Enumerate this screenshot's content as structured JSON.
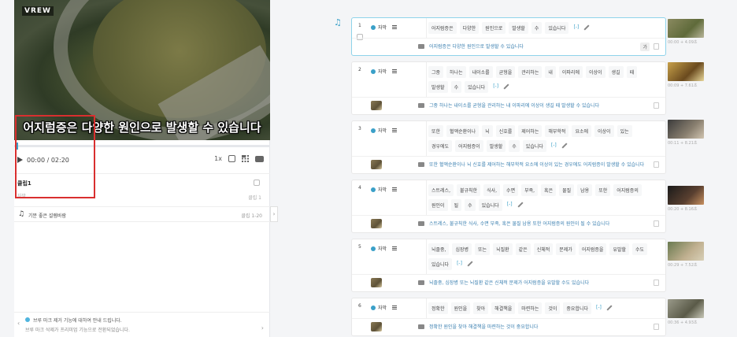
{
  "player": {
    "logo": "VREW",
    "subtitle": "어지럼증은 다양한 원인으로 발생할 수 있습니다",
    "time": "00:00  / 02:20",
    "speed": "1x",
    "progress": 0.01
  },
  "clip_panel": {
    "title": "클립1",
    "sub": "자막",
    "count": "클립 1",
    "music_label": "기분 좋은 설렘바람",
    "music_range": "클립 1-20"
  },
  "notice": {
    "line1": "브루 마크 제거 기능에 대하여 안내 드립니다.",
    "line2": "브루 마크 삭제가 프리미엄 기능으로 전환되었습니다."
  },
  "speaker_label": "자막",
  "clips": [
    {
      "num": "1",
      "words": [
        "어지럼증은",
        "다양한",
        "원인으로",
        "발생할",
        "수",
        "있습니다"
      ],
      "caption": "어지럼증은 다양한 원인으로 발생할 수 있습니다",
      "badge": "가",
      "thumb_time": "00:00 + 4.09초"
    },
    {
      "num": "2",
      "words": [
        "그중",
        "하나는",
        "내이소를",
        "균형을",
        "관리하는",
        "내",
        "이파리에",
        "이상이",
        "생길",
        "때",
        "발생할",
        "수",
        "있습니다"
      ],
      "caption": "그중 하나는 내이소를 균형을 관리하는 내 이파리에 이상이 생길 때 발생할 수 있습니다",
      "thumb_time": "00:09 + 7.61초"
    },
    {
      "num": "3",
      "words": [
        "또한",
        "혈액순환이나",
        "뇌",
        "신호를",
        "제어하는",
        "해부학적",
        "요소에",
        "이상이",
        "있는",
        "경우에도",
        "어지럼증이",
        "발생할",
        "수",
        "있습니다"
      ],
      "caption": "또한 혈액순환이나 뇌 신호를 제어하는 해부학적 요소에 이상이 있는 경우에도 어지럼증이 발생할 수 있습니다",
      "thumb_time": "00:11 + 8.21초"
    },
    {
      "num": "4",
      "words": [
        "스트레스,",
        "불규칙한",
        "식사,",
        "수면",
        "부족,",
        "혹은",
        "물질",
        "남용",
        "또한",
        "어지럼증의",
        "원인이",
        "될",
        "수",
        "있습니다"
      ],
      "caption": "스트레스, 불규칙한 식사, 수면 부족, 혹은 물질 남용 또한 어지럼증의 원인이 될 수 있습니다",
      "thumb_time": "00:20 + 8.16초"
    },
    {
      "num": "5",
      "words": [
        "뇌졸중,",
        "심장병",
        "또는",
        "뇌질환",
        "같은",
        "신체적",
        "문제가",
        "어지럼증을",
        "유발할",
        "수도",
        "있습니다"
      ],
      "caption": "뇌졸중, 심장병 또는 뇌질환 같은 신체적 문제가 어지럼증을 유발할 수도 있습니다",
      "thumb_time": "00:29 + 7.52초"
    },
    {
      "num": "6",
      "words": [
        "정확한",
        "원인을",
        "찾아",
        "해결책을",
        "마련하는",
        "것이",
        "중요합니다"
      ],
      "caption": "정확한 원인을 찾아 해결책을 마련하는 것이 중요합니다",
      "thumb_time": "00:36 + 4.93초"
    }
  ],
  "mark_label": "[-]",
  "colors": {
    "accent": "#3aa0c8",
    "highlight_box": "#d92f2f",
    "active_border": "#8fd3ea"
  }
}
